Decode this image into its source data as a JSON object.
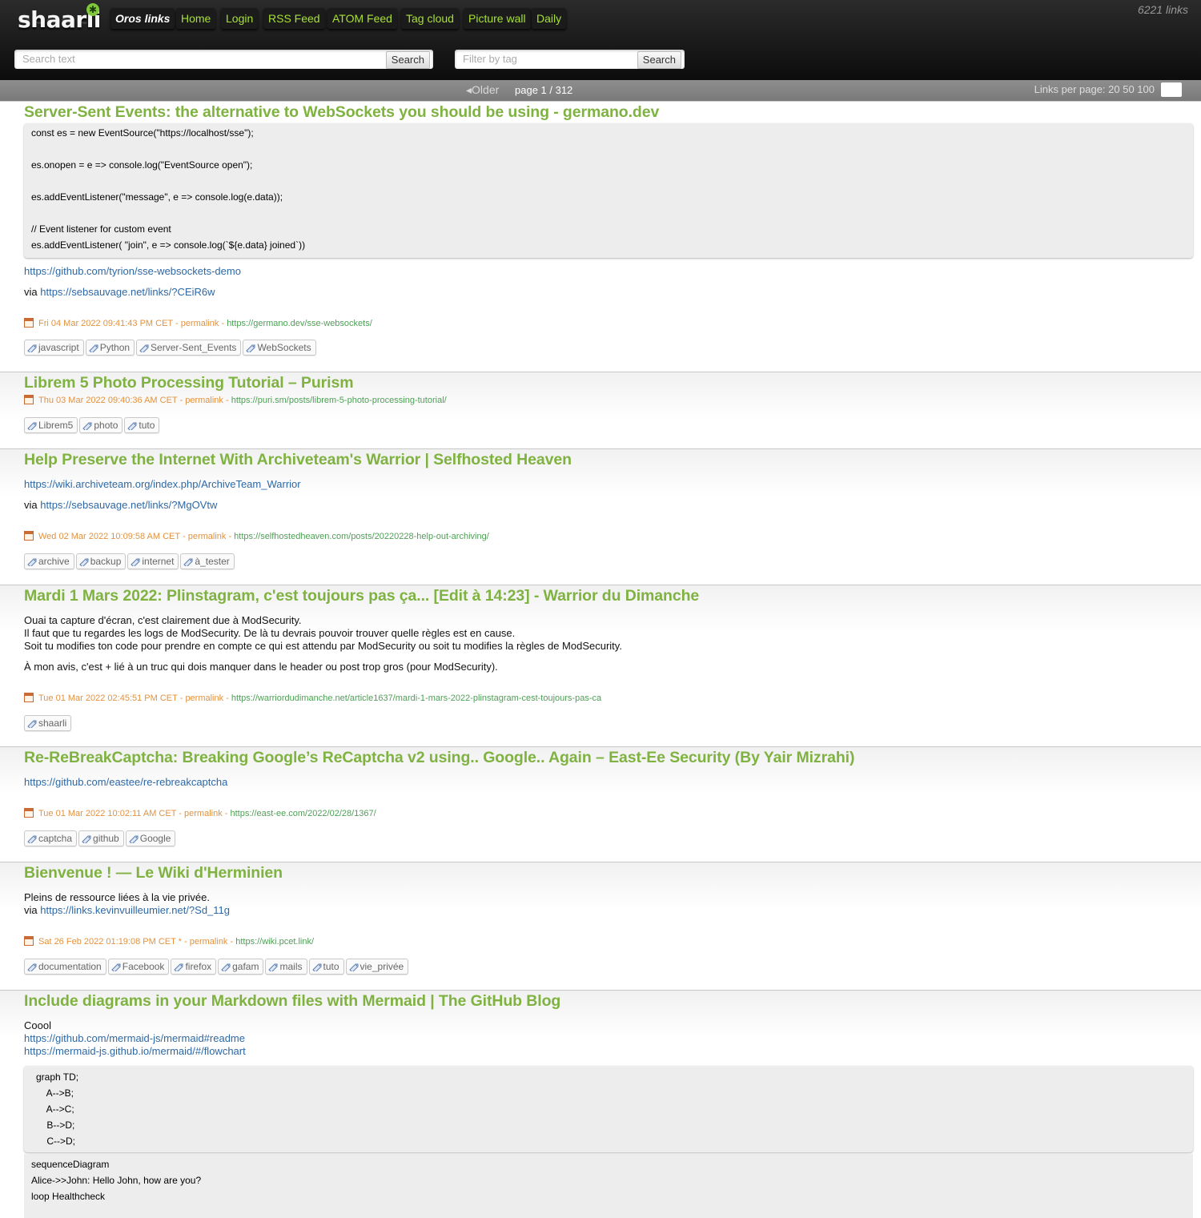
{
  "header": {
    "logo": "shaarli",
    "nav": [
      {
        "label": "Oros links",
        "name": "nav-title",
        "left": 0,
        "title": true
      },
      {
        "label": "Home",
        "name": "nav-home"
      },
      {
        "label": "Login",
        "name": "nav-login"
      },
      {
        "label": "RSS Feed",
        "name": "nav-rss-feed"
      },
      {
        "label": "ATOM Feed",
        "name": "nav-atom-feed"
      },
      {
        "label": "Tag cloud",
        "name": "nav-tag-cloud"
      },
      {
        "label": "Picture wall",
        "name": "nav-picture-wall"
      },
      {
        "label": "Daily",
        "name": "nav-daily"
      }
    ],
    "link_count": "6221 links",
    "search_text_placeholder": "Search text",
    "search_tag_placeholder": "Filter by tag",
    "search_label": "Search"
  },
  "paging": {
    "older": "◂Older",
    "page": "page 1 / 312",
    "per_page": "Links per page: 20 50 100"
  },
  "links": [
    {
      "title": "Server-Sent Events: the alternative to WebSockets you should be using - germano.dev",
      "code": [
        "const es = new EventSource(\"https://localhost/sse\");",
        "",
        "es.onopen = e => console.log(\"EventSource open\");",
        "",
        "es.addEventListener(\"message\", e => console.log(e.data));",
        "",
        "// Event listener for custom event",
        "es.addEventListener( \"join\", e => console.log(`${e.data} joined`))"
      ],
      "body_link": "https://github.com/tyrion/sse-websockets-demo",
      "via_prefix": "via ",
      "via_link": "https://sebsauvage.net/links/?CEiR6w",
      "date": "Fri 04 Mar 2022 09:41:43 PM CET - ",
      "permalink": "permalink",
      "sep": " - ",
      "url": "https://germano.dev/sse-websockets/",
      "tags": [
        "javascript",
        "Python",
        "Server-Sent_Events",
        "WebSockets"
      ]
    },
    {
      "title": "Librem 5 Photo Processing Tutorial – Purism",
      "date": "Thu 03 Mar 2022 09:40:36 AM CET - ",
      "permalink": "permalink",
      "sep": " - ",
      "url": "https://puri.sm/posts/librem-5-photo-processing-tutorial/",
      "tags": [
        "Librem5",
        "photo",
        "tuto"
      ]
    },
    {
      "title": "Help Preserve the Internet With Archiveteam's Warrior | Selfhosted Heaven",
      "body_link": "https://wiki.archiveteam.org/index.php/ArchiveTeam_Warrior",
      "via_prefix": "via ",
      "via_link": "https://sebsauvage.net/links/?MgOVtw",
      "date": "Wed 02 Mar 2022 10:09:58 AM CET - ",
      "permalink": "permalink",
      "sep": " - ",
      "url": "https://selfhostedheaven.com/posts/20220228-help-out-archiving/",
      "tags": [
        "archive",
        "backup",
        "internet",
        "à_tester"
      ]
    },
    {
      "title": "Mardi 1 Mars 2022: Plinstagram, c'est toujours pas ça... [Edit à 14:23] - Warrior du Dimanche",
      "lines": [
        "Ouai ta capture d'écran, c'est clairement due à ModSecurity.",
        "Il faut que tu regardes les logs de ModSecurity. De là tu devrais pouvoir trouver quelle règles est en cause.",
        "Soit tu modifies ton code pour prendre en compte ce qui est attendu par ModSecurity ou soit tu modifies la règles de ModSecurity."
      ],
      "line2": "À mon avis, c'est + lié à un truc qui dois manquer dans le header ou post trop gros (pour ModSecurity).",
      "date": "Tue 01 Mar 2022 02:45:51 PM CET - ",
      "permalink": "permalink",
      "sep": " - ",
      "url": "https://warriordudimanche.net/article1637/mardi-1-mars-2022-plinstagram-cest-toujours-pas-ca",
      "tags": [
        "shaarli"
      ]
    },
    {
      "title": "Re-ReBreakCaptcha: Breaking Google’s ReCaptcha v2 using.. Google.. Again – East-Ee Security (By Yair Mizrahi)",
      "body_link": "https://github.com/eastee/re-rebreakcaptcha",
      "date": "Tue 01 Mar 2022 10:02:11 AM CET - ",
      "permalink": "permalink",
      "sep": " - ",
      "url": "https://east-ee.com/2022/02/28/1367/",
      "tags": [
        "captcha",
        "github",
        "Google"
      ]
    },
    {
      "title": "Bienvenue ! — Le Wiki d'Herminien",
      "text": "Pleins de ressource liées à la vie privée.",
      "via_prefix": "via ",
      "via_link": "https://links.kevinvuilleumier.net/?Sd_11g",
      "date": "Sat 26 Feb 2022 01:19:08 PM CET * - ",
      "permalink": "permalink",
      "sep": " - ",
      "url": "https://wiki.pcet.link/",
      "tags": [
        "documentation",
        "Facebook",
        "firefox",
        "gafam",
        "mails",
        "tuto",
        "vie_privée"
      ]
    },
    {
      "title": "Include diagrams in your Markdown files with Mermaid | The GitHub Blog",
      "text": "Coool",
      "links": [
        "https://github.com/mermaid-js/mermaid#readme",
        "https://mermaid-js.github.io/mermaid/#/flowchart"
      ],
      "code1": [
        "graph TD;",
        "    A-->B;",
        "    A-->C;",
        "    B-->D;",
        "    C-->D;"
      ],
      "code2": [
        "sequenceDiagram",
        "Alice->>John: Hello John, how are you?",
        "loop Healthcheck"
      ]
    }
  ]
}
